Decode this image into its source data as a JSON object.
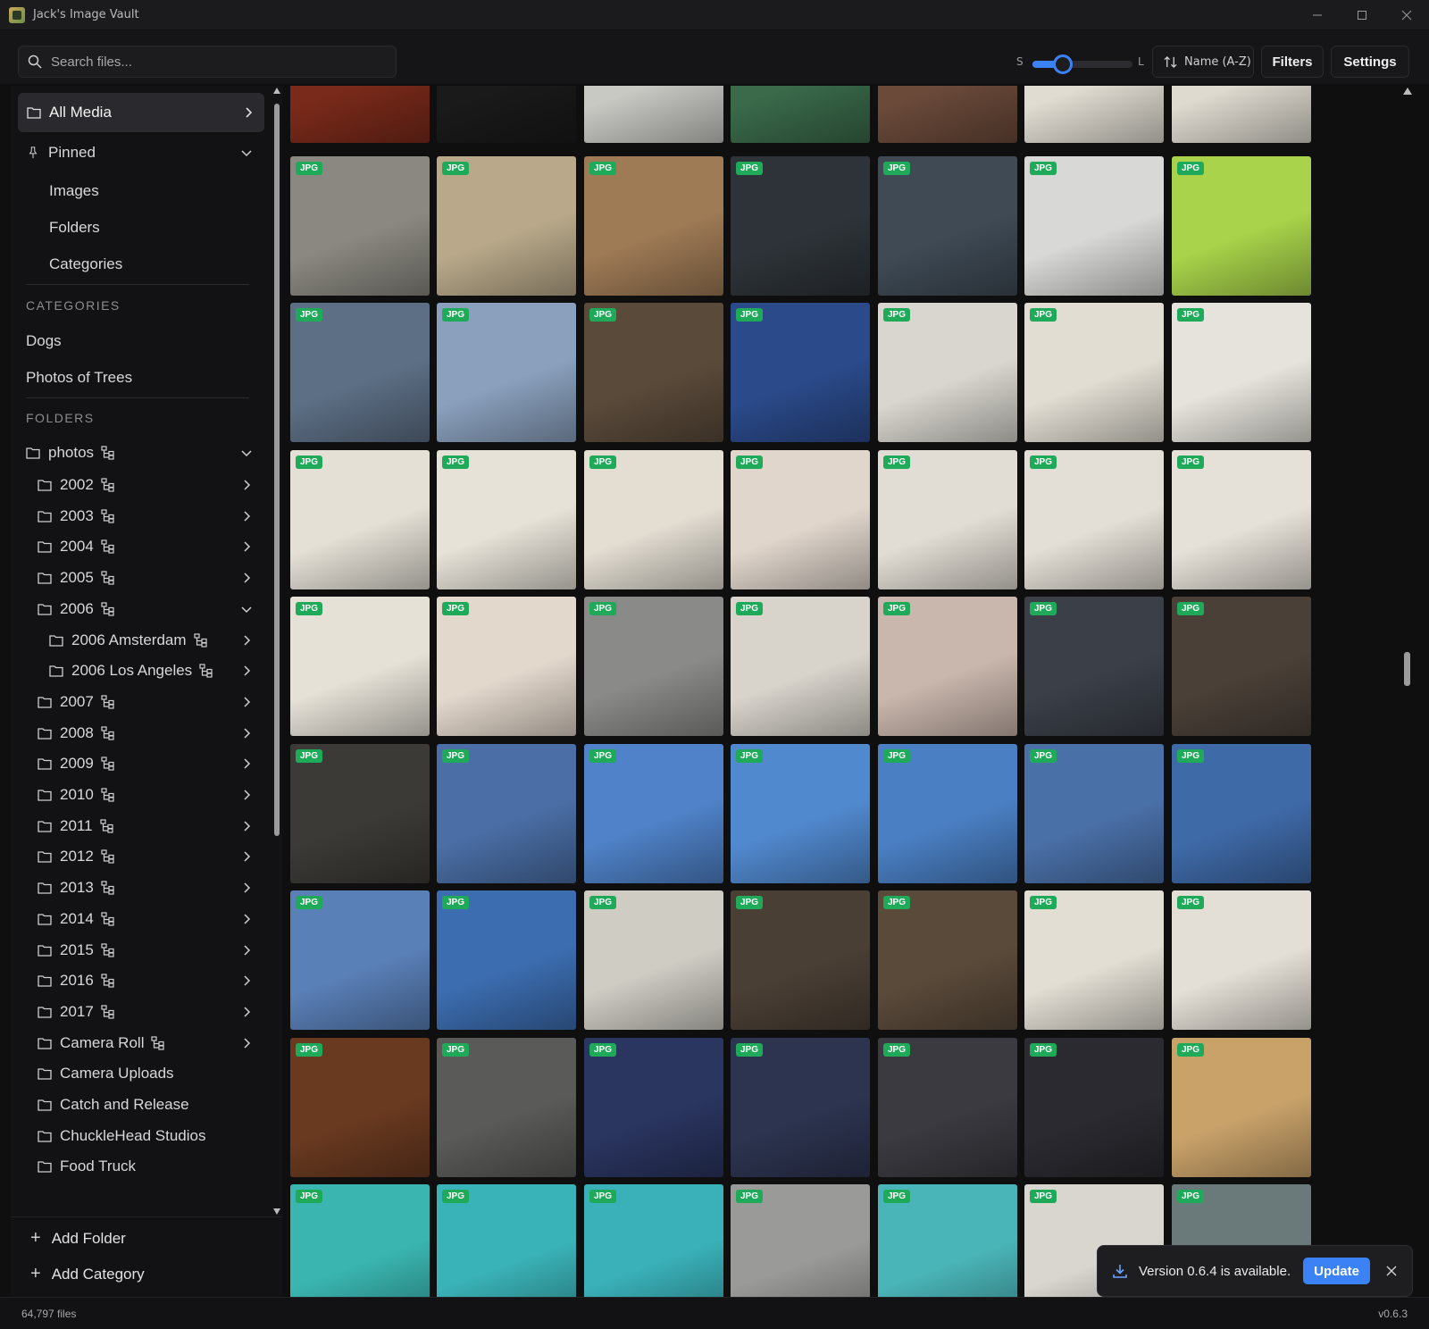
{
  "window": {
    "title": "Jack's Image Vault"
  },
  "toolbar": {
    "search_placeholder": "Search files...",
    "size_small_label": "S",
    "size_large_label": "L",
    "size_value": 0.3,
    "sort_label": "Name (A-Z)",
    "filters_label": "Filters",
    "settings_label": "Settings"
  },
  "sidebar": {
    "all_media": "All Media",
    "pinned": {
      "label": "Pinned",
      "items": [
        "Images",
        "Folders",
        "Categories"
      ]
    },
    "categories_heading": "CATEGORIES",
    "categories": [
      "Dogs",
      "Photos of Trees"
    ],
    "folders_heading": "FOLDERS",
    "root_folder": "photos",
    "years_before": [
      "2002",
      "2003",
      "2004",
      "2005",
      "2006"
    ],
    "subfolders_2006": [
      "2006 Amsterdam",
      "2006 Los Angeles"
    ],
    "years_after": [
      "2007",
      "2008",
      "2009",
      "2010",
      "2011",
      "2012",
      "2013",
      "2014",
      "2015",
      "2016",
      "2017"
    ],
    "other_folders": [
      {
        "name": "Camera Roll",
        "tree": true,
        "chevron": true
      },
      {
        "name": "Camera Uploads",
        "tree": false,
        "chevron": false
      },
      {
        "name": "Catch and Release",
        "tree": false,
        "chevron": false
      },
      {
        "name": "ChuckleHead Studios",
        "tree": false,
        "chevron": false
      },
      {
        "name": "Food Truck",
        "tree": false,
        "chevron": false
      }
    ],
    "add_folder": "Add Folder",
    "add_category": "Add Category"
  },
  "grid": {
    "badge": "JPG",
    "rows": [
      {
        "badges": false,
        "colors": [
          "#7a2a1a",
          "#1a1a1a",
          "#c9c9c4",
          "#3a6a4a",
          "#6b4a3a",
          "#e0dcd2",
          "#dedad0"
        ]
      },
      {
        "badges": true,
        "colors": [
          "#8a8880",
          "#b9a98a",
          "#9e7a55",
          "#2d3338",
          "#3f4a55",
          "#d8d8d6",
          "#a8d34a"
        ]
      },
      {
        "badges": true,
        "colors": [
          "#5d6f85",
          "#8aa0bd",
          "#5a4a3a",
          "#2b4a8a",
          "#d9d6cf",
          "#e1ddd3",
          "#e6e3dc"
        ]
      },
      {
        "badges": true,
        "colors": [
          "#e4e0d6",
          "#e6e2d8",
          "#e3ddd2",
          "#e0d6cc",
          "#e2ddd4",
          "#e4dfd6",
          "#e6e1d8"
        ]
      },
      {
        "badges": true,
        "colors": [
          "#e5e1d7",
          "#e3d8cc",
          "#8a8a88",
          "#d8d4cc",
          "#c9b6ac",
          "#3a3f48",
          "#4a4038"
        ]
      },
      {
        "badges": true,
        "colors": [
          "#3b3a36",
          "#4a6ea5",
          "#4f82c8",
          "#5189cf",
          "#4a7fc3",
          "#4a70a8",
          "#3f6aa8"
        ]
      },
      {
        "badges": true,
        "colors": [
          "#5a80b8",
          "#3c6db0",
          "#cfccc4",
          "#4a3f35",
          "#5a4a3a",
          "#e2ded4",
          "#e4dfd6"
        ]
      },
      {
        "badges": true,
        "colors": [
          "#6a3a20",
          "#5a5a58",
          "#2a3560",
          "#2d3450",
          "#3a3a40",
          "#2a2a30",
          "#c9a26a"
        ]
      },
      {
        "badges": true,
        "colors": [
          "#3ab5b0",
          "#3ab3b8",
          "#3ab0b8",
          "#9a9a98",
          "#4ab5b8",
          "#d9d6cf",
          "#6a7a7a"
        ]
      }
    ]
  },
  "toast": {
    "message": "Version 0.6.4 is available.",
    "button": "Update"
  },
  "status": {
    "file_count": "64,797 files",
    "version": "v0.6.3"
  },
  "colors": {
    "accent": "#3b82f6",
    "badge": "#1faa5a"
  }
}
